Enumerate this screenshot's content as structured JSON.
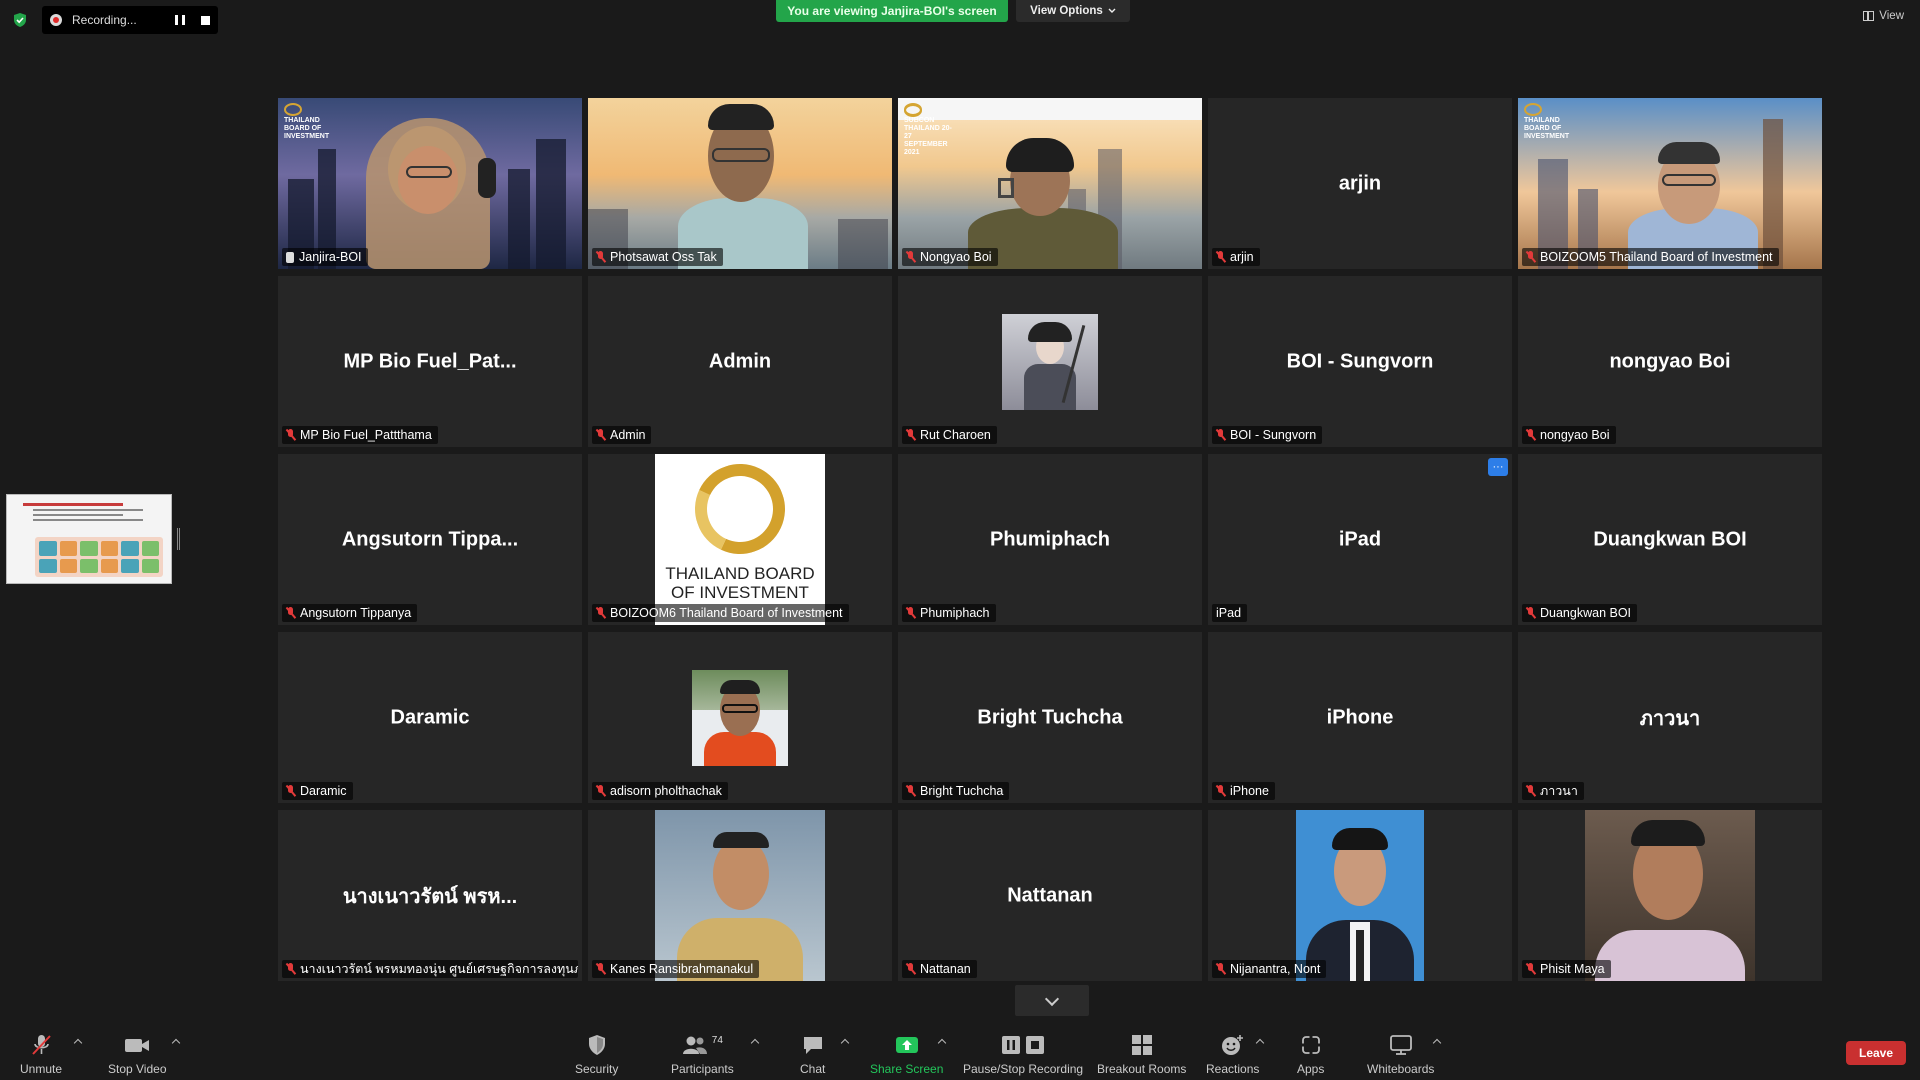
{
  "recording": {
    "label": "Recording..."
  },
  "banner": {
    "text": "You are viewing Janjira-BOI's screen"
  },
  "view_options": {
    "label": "View Options"
  },
  "view_button": {
    "label": "View"
  },
  "tiles": [
    {
      "label": "Janjira-BOI",
      "name": "",
      "kind": "video",
      "scene": "janjira",
      "brand": "THAILAND BOARD OF INVESTMENT",
      "active": true,
      "pinned": true
    },
    {
      "label": "Photsawat Oss Tak",
      "name": "",
      "kind": "video",
      "scene": "photsawat"
    },
    {
      "label": "Nongyao Boi",
      "name": "",
      "kind": "video",
      "scene": "nongyao",
      "brand": "SUBCON THAILAND   20-27 SEPTEMBER 2021"
    },
    {
      "label": "arjin",
      "name": "arjin",
      "kind": "name"
    },
    {
      "label": "BOIZOOM5 Thailand Board of Investment",
      "name": "",
      "kind": "video",
      "scene": "boizoom5",
      "brand": "THAILAND BOARD OF INVESTMENT"
    },
    {
      "label": "MP Bio Fuel_Pattthama",
      "name": "MP Bio Fuel_Pat...",
      "kind": "name"
    },
    {
      "label": "Admin",
      "name": "Admin",
      "kind": "name"
    },
    {
      "label": "Rut Charoen",
      "name": "",
      "kind": "avatar",
      "scene": "rut"
    },
    {
      "label": "BOI - Sungvorn",
      "name": "BOI - Sungvorn",
      "kind": "name"
    },
    {
      "label": "nongyao Boi",
      "name": "nongyao Boi",
      "kind": "name"
    },
    {
      "label": "Angsutorn Tippanya",
      "name": "Angsutorn Tippa...",
      "kind": "name"
    },
    {
      "label": "BOIZOOM6 Thailand Board of Investment",
      "name": "",
      "kind": "logo",
      "logo_text": "THAILAND BOARD OF INVESTMENT"
    },
    {
      "label": "Phumiphach",
      "name": "Phumiphach",
      "kind": "name"
    },
    {
      "label": "iPad",
      "name": "iPad",
      "kind": "name",
      "unmuted": true,
      "more": "···"
    },
    {
      "label": "Duangkwan BOI",
      "name": "Duangkwan BOI",
      "kind": "name"
    },
    {
      "label": "Daramic",
      "name": "Daramic",
      "kind": "name"
    },
    {
      "label": "adisorn pholthachak",
      "name": "",
      "kind": "avatar",
      "scene": "adisorn"
    },
    {
      "label": "Bright Tuchcha",
      "name": "Bright Tuchcha",
      "kind": "name"
    },
    {
      "label": "iPhone",
      "name": "iPhone",
      "kind": "name"
    },
    {
      "label": "ภาวนา",
      "name": "ภาวนา",
      "kind": "name"
    },
    {
      "label": "นางเนาวรัตน์ พรหมทองนุ่น ศูนย์เศรษฐกิจการลงทุนภา...",
      "name": "นางเนาวรัตน์ พรห...",
      "kind": "name"
    },
    {
      "label": "Kanes Ransibrahmanakul",
      "name": "",
      "kind": "portrait",
      "scene": "kanes"
    },
    {
      "label": "Nattanan",
      "name": "Nattanan",
      "kind": "name"
    },
    {
      "label": "Nijanantra, Nont",
      "name": "",
      "kind": "portrait",
      "scene": "nijanantra"
    },
    {
      "label": "Phisit Maya",
      "name": "",
      "kind": "portrait",
      "scene": "phisit"
    }
  ],
  "toolbar": {
    "unmute": "Unmute",
    "stop_video": "Stop Video",
    "security": "Security",
    "participants": "Participants",
    "participants_count": "74",
    "chat": "Chat",
    "share_screen": "Share Screen",
    "pause_stop_recording": "Pause/Stop Recording",
    "breakout_rooms": "Breakout Rooms",
    "reactions": "Reactions",
    "apps": "Apps",
    "whiteboards": "Whiteboards",
    "leave": "Leave"
  },
  "colors": {
    "accent_green": "#23a54a",
    "active_border": "#d9e25a",
    "leave_red": "#c93030",
    "muted_red": "#e23a3a"
  }
}
